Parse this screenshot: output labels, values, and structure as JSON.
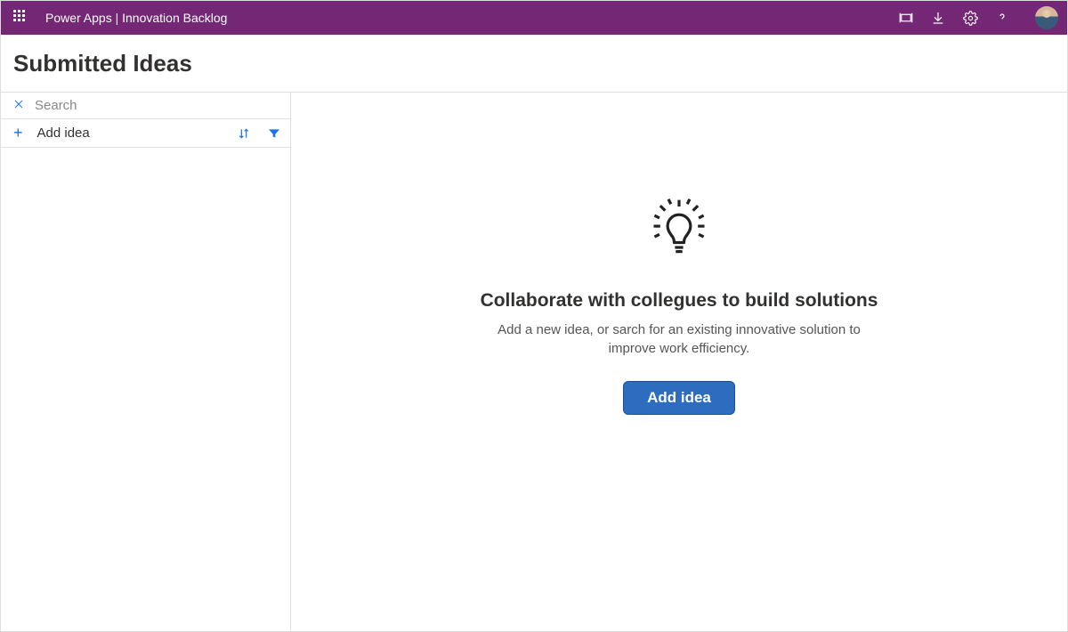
{
  "header": {
    "app_title": "Power Apps   |   Innovation Backlog"
  },
  "page": {
    "title": "Submitted Ideas"
  },
  "sidebar": {
    "search_placeholder": "Search",
    "add_label": "Add idea"
  },
  "empty": {
    "title": "Collaborate with collegues to build solutions",
    "subtitle": "Add a new idea, or sarch for an existing innovative solution to improve work efficiency.",
    "button": "Add idea"
  }
}
